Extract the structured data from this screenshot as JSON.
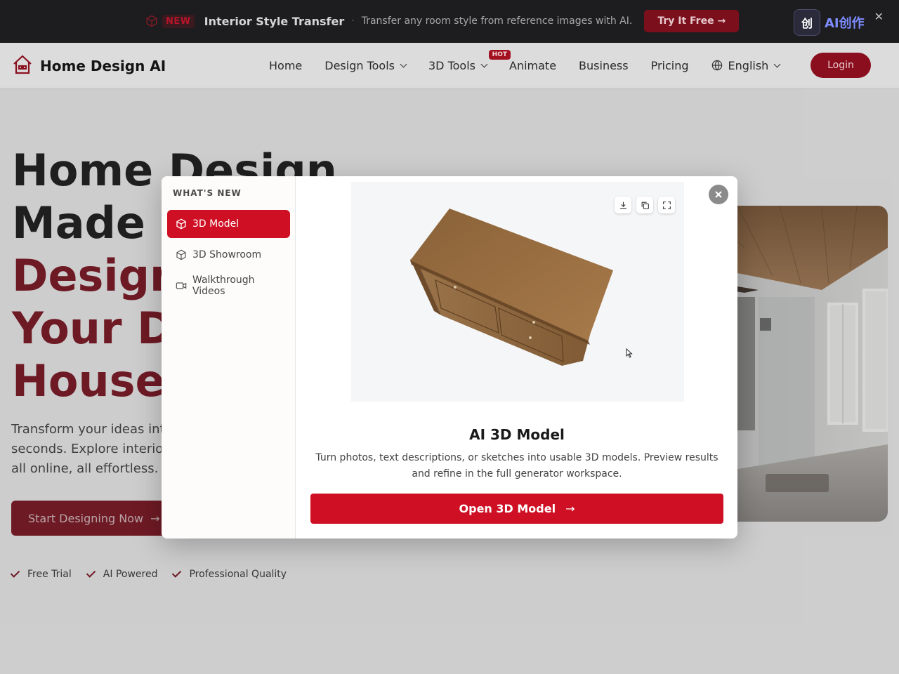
{
  "promo": {
    "badge": "NEW",
    "title": "Interior Style Transfer",
    "separator": "·",
    "description": "Transfer any room style from reference images with AI.",
    "cta": "Try It Free →",
    "partner_logo_text": "AI创作",
    "partner_icon_glyph": "创",
    "close_glyph": "✕"
  },
  "nav": {
    "brand": "Home Design AI",
    "items": [
      {
        "label": "Home"
      },
      {
        "label": "Design Tools"
      },
      {
        "label": "3D Tools",
        "badge": "HOT"
      },
      {
        "label": "Animate"
      },
      {
        "label": "Business"
      },
      {
        "label": "Pricing"
      },
      {
        "label": "English"
      }
    ],
    "login": "Login"
  },
  "hero": {
    "title_line1": "Home Design",
    "title_line2": "Made S",
    "title_line3": "Design",
    "title_line4": "Your D",
    "title_line5": "House",
    "subtitle_line1": "Transform your ideas int",
    "subtitle_line2": "seconds. Explore interio",
    "subtitle_line3": "all online, all effortless.",
    "cta": "Start Designing Now",
    "cta_arrow": "→",
    "checks": [
      "Free Trial",
      "AI Powered",
      "Professional Quality"
    ]
  },
  "modal": {
    "sidebar_title": "WHAT'S NEW",
    "sidebar_items": [
      {
        "label": "3D Model",
        "icon": "cube-icon",
        "active": true
      },
      {
        "label": "3D Showroom",
        "icon": "cube-outline-icon",
        "active": false
      },
      {
        "label": "Walkthrough Videos",
        "icon": "video-camera-icon",
        "active": false
      }
    ],
    "title": "AI 3D Model",
    "description": "Turn photos, text descriptions, or sketches into usable 3D models. Preview results and refine in the full generator workspace.",
    "cta": "Open 3D Model",
    "cta_arrow": "→",
    "viewer_tools": [
      "download-icon",
      "copy-icon",
      "fullscreen-icon"
    ]
  },
  "colors": {
    "brand_red": "#cf1024",
    "dim_red": "#7a0f1b",
    "banner_bg": "#1d1d1f"
  }
}
